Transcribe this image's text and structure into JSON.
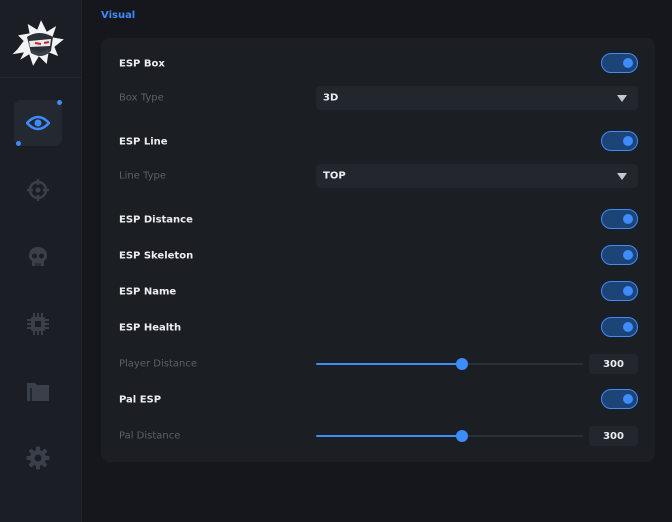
{
  "colors": {
    "accent": "#3d8bfd",
    "background": "#15171c",
    "panel": "#1b1e23",
    "sidebar": "#1b1e24"
  },
  "sidebar": {
    "logo": "ninja-mascot-logo",
    "items": [
      {
        "icon": "eye-icon",
        "active": true
      },
      {
        "icon": "crosshair-icon",
        "active": false
      },
      {
        "icon": "skull-icon",
        "active": false
      },
      {
        "icon": "chip-icon",
        "active": false
      },
      {
        "icon": "folder-icon",
        "active": false
      },
      {
        "icon": "gear-icon",
        "active": false
      }
    ]
  },
  "section": {
    "title": "Visual"
  },
  "settings": {
    "esp_box": {
      "label": "ESP Box",
      "enabled": true
    },
    "box_type": {
      "label": "Box Type",
      "value": "3D"
    },
    "esp_line": {
      "label": "ESP Line",
      "enabled": true
    },
    "line_type": {
      "label": "Line Type",
      "value": "TOP"
    },
    "esp_distance": {
      "label": "ESP Distance",
      "enabled": true
    },
    "esp_skeleton": {
      "label": "ESP Skeleton",
      "enabled": true
    },
    "esp_name": {
      "label": "ESP Name",
      "enabled": true
    },
    "esp_health": {
      "label": "ESP Health",
      "enabled": true
    },
    "player_distance": {
      "label": "Player Distance",
      "value": "300",
      "fraction": 0.545
    },
    "pal_esp": {
      "label": "Pal ESP",
      "enabled": true
    },
    "pal_distance": {
      "label": "Pal Distance",
      "value": "300",
      "fraction": 0.545
    }
  }
}
